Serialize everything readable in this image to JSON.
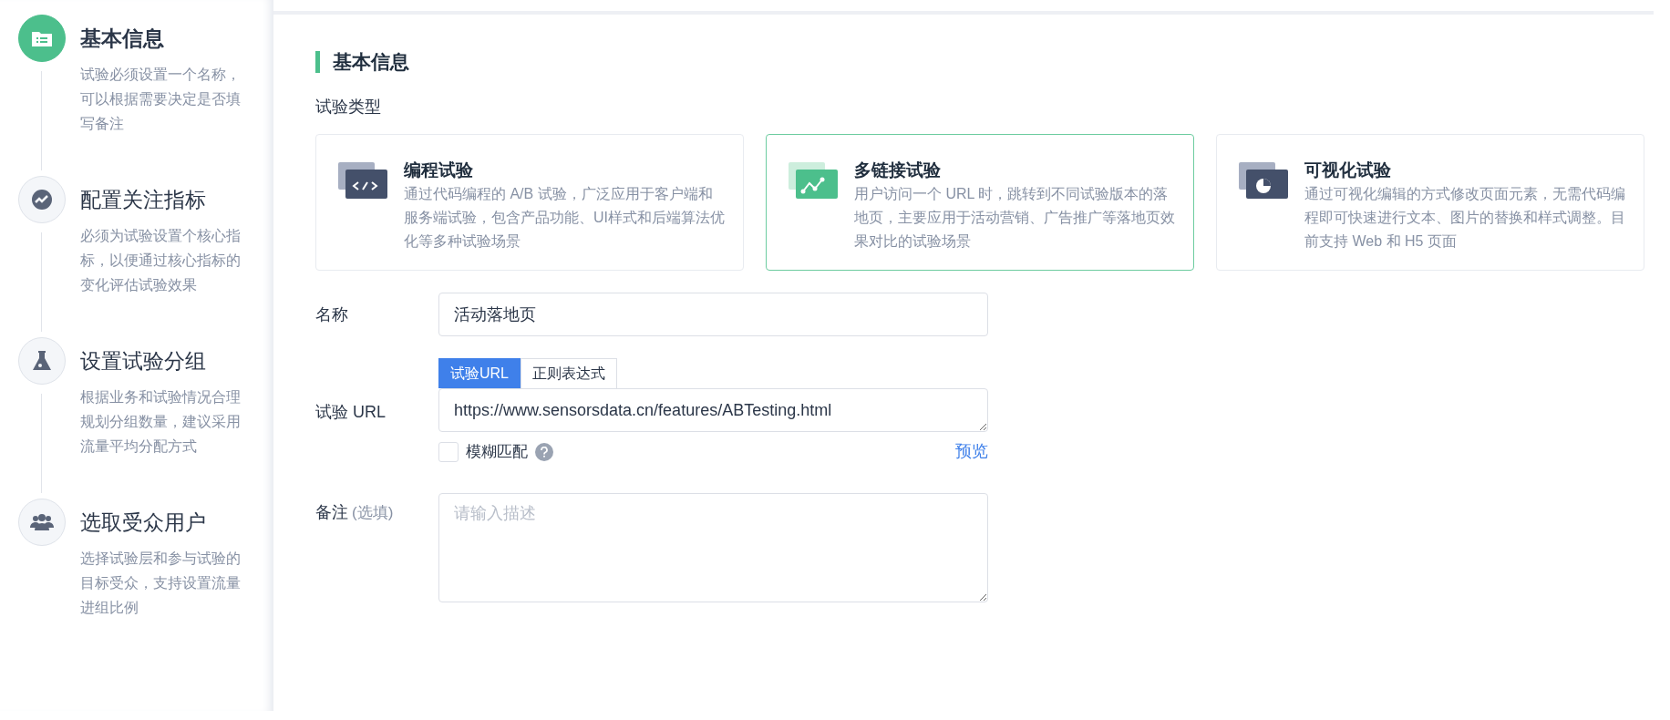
{
  "steps": [
    {
      "kind": "info",
      "title": "基本信息",
      "description": "试验必须设置一个名称，可以根据需要决定是否填写备注",
      "active": true
    },
    {
      "kind": "metric",
      "title": "配置关注指标",
      "description": "必须为试验设置个核心指标，以便通过核心指标的变化评估试验效果",
      "active": false
    },
    {
      "kind": "flask",
      "title": "设置试验分组",
      "description": "根据业务和试验情况合理规划分组数量，建议采用流量平均分配方式",
      "active": false
    },
    {
      "kind": "users",
      "title": "选取受众用户",
      "description": "选择试验层和参与试验的目标受众，支持设置流量进组比例",
      "active": false
    }
  ],
  "section_title": "基本信息",
  "type_label": "试验类型",
  "types": [
    {
      "kind": "code",
      "title": "编程试验",
      "description": "通过代码编程的 A/B 试验，广泛应用于客户端和服务端试验，包含产品功能、UI样式和后端算法优化等多种试验场景",
      "selected": false
    },
    {
      "kind": "link",
      "title": "多链接试验",
      "description": "用户访问一个 URL 时，跳转到不同试验版本的落地页，主要应用于活动营销、广告推广等落地页效果对比的试验场景",
      "selected": true
    },
    {
      "kind": "visual",
      "title": "可视化试验",
      "description": "通过可视化编辑的方式修改页面元素，无需代码编程即可快速进行文本、图片的替换和样式调整。目前支持 Web 和 H5 页面",
      "selected": false
    }
  ],
  "name_field": {
    "label": "名称",
    "value": "活动落地页"
  },
  "url_field": {
    "label": "试验 URL",
    "tabs": [
      {
        "label": "试验URL",
        "selected": true
      },
      {
        "label": "正则表达式",
        "selected": false
      }
    ],
    "value": "https://www.sensorsdata.cn/features/ABTesting.html",
    "fuzzy_match": {
      "label": "模糊匹配",
      "checked": false
    },
    "preview_link": "预览"
  },
  "notes_field": {
    "label": "备注",
    "optional_note": "(选填)",
    "placeholder": "请输入描述"
  }
}
